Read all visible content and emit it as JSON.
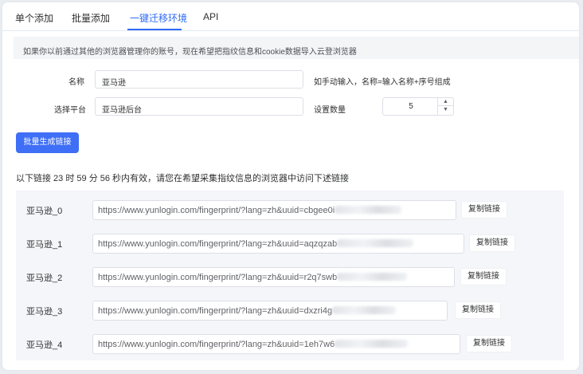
{
  "tabs": [
    {
      "label": "单个添加",
      "active": false
    },
    {
      "label": "批量添加",
      "active": false
    },
    {
      "label": "一键迁移环境",
      "active": true
    },
    {
      "label": "API",
      "active": false
    }
  ],
  "notice": "如果你以前通过其他的浏览器管理你的账号，现在希望把指纹信息和cookie数据导入云登浏览器",
  "form": {
    "name_label": "名称",
    "name_value": "亚马逊",
    "name_hint": "如手动输入，名称=输入名称+序号组成",
    "platform_label": "选择平台",
    "platform_value": "亚马逊后台",
    "count_label": "设置数量",
    "count_value": "5"
  },
  "generate_button": "批量生成链接",
  "validity_text": "以下链接 23 时 59 分 56 秒内有效，请您在希望采集指纹信息的浏览器中访问下述链接",
  "copy_label": "复制链接",
  "links": [
    {
      "label": "亚马逊_0",
      "url": "https://www.yunlogin.com/fingerprint/?lang=zh&uuid=cbgee0i"
    },
    {
      "label": "亚马逊_1",
      "url": "https://www.yunlogin.com/fingerprint/?lang=zh&uuid=aqzqzab"
    },
    {
      "label": "亚马逊_2",
      "url": "https://www.yunlogin.com/fingerprint/?lang=zh&uuid=r2q7swb"
    },
    {
      "label": "亚马逊_3",
      "url": "https://www.yunlogin.com/fingerprint/?lang=zh&uuid=dxzri4g"
    },
    {
      "label": "亚马逊_4",
      "url": "https://www.yunlogin.com/fingerprint/?lang=zh&uuid=1eh7w6"
    }
  ],
  "colors": {
    "accent": "#2f6bf6",
    "primary_button": "#3f6ff6"
  }
}
